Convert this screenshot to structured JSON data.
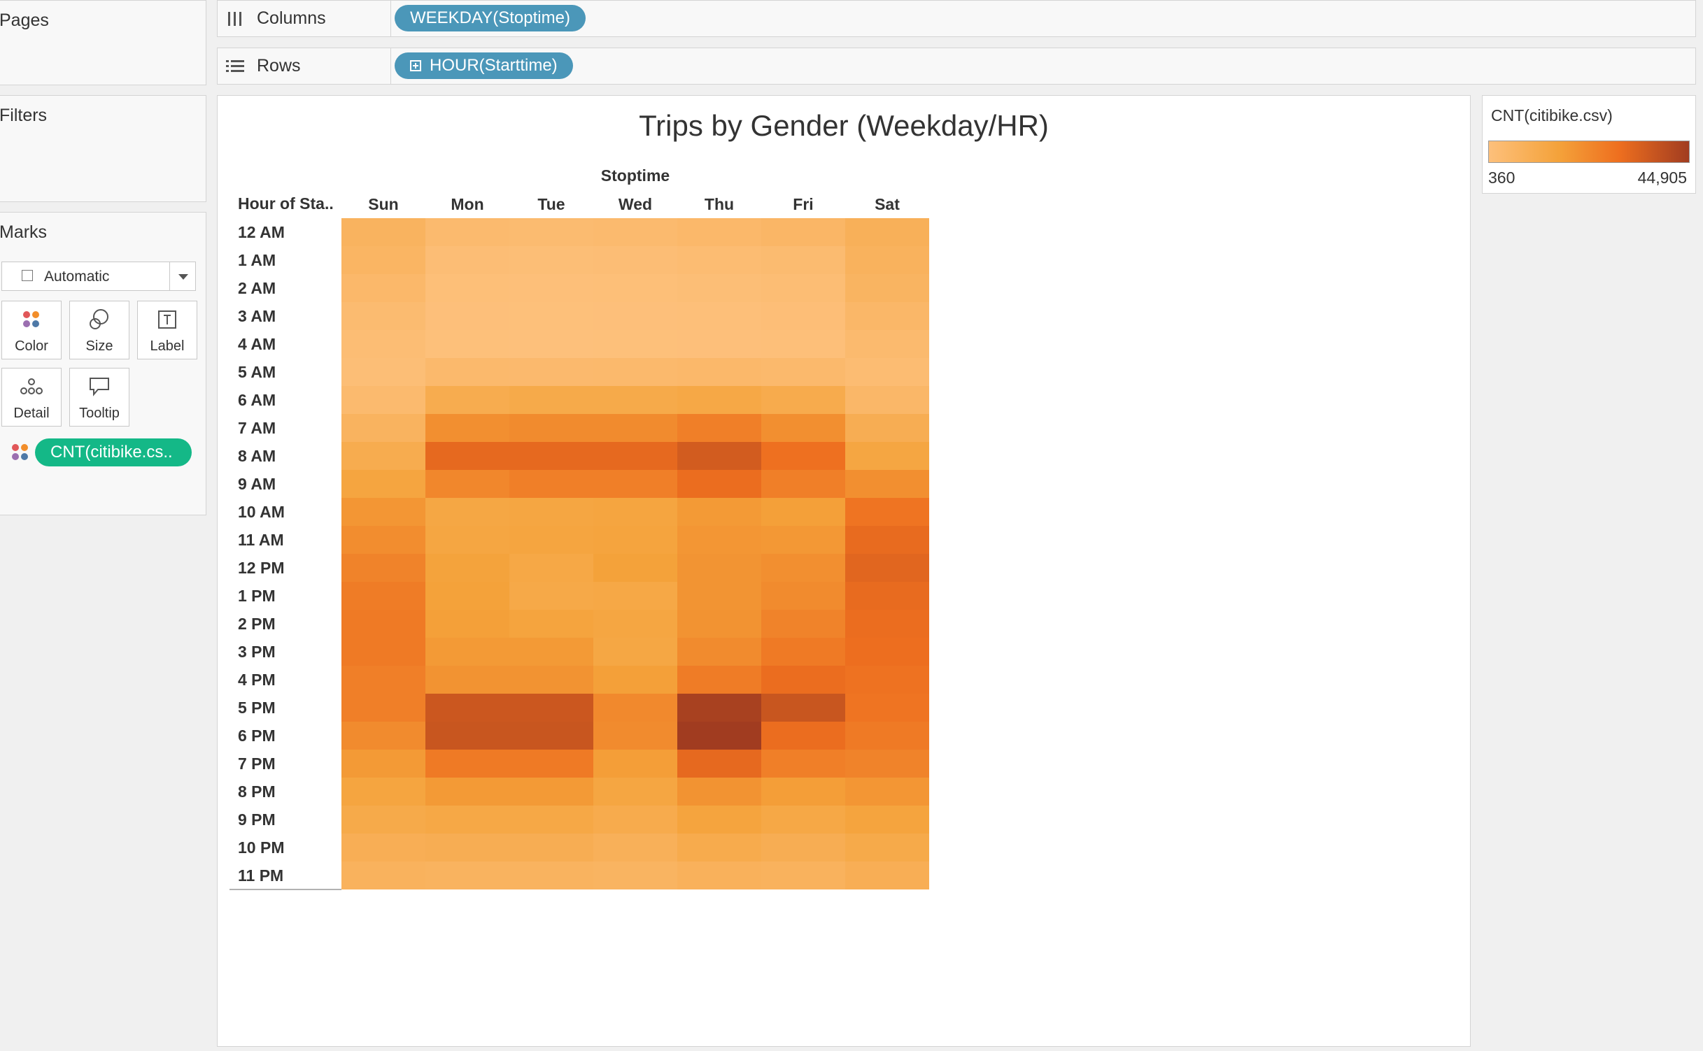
{
  "pages": {
    "title": "Pages"
  },
  "filters": {
    "title": "Filters"
  },
  "marks": {
    "title": "Marks",
    "type": "Automatic",
    "buttons": [
      {
        "label": "Color",
        "icon": "color-dots-icon"
      },
      {
        "label": "Size",
        "icon": "size-icon"
      },
      {
        "label": "Label",
        "icon": "label-icon"
      },
      {
        "label": "Detail",
        "icon": "detail-icon"
      },
      {
        "label": "Tooltip",
        "icon": "tooltip-icon"
      }
    ],
    "color_field": "CNT(citibike.cs.."
  },
  "shelves": {
    "columns": {
      "label": "Columns",
      "pill": "WEEKDAY(Stoptime)"
    },
    "rows": {
      "label": "Rows",
      "pill": "HOUR(Starttime)"
    }
  },
  "legend": {
    "title": "CNT(citibike.csv)",
    "min": "360",
    "max": "44,905",
    "color_low": "#fdc07b",
    "color_mid": "#ee6f1f",
    "color_high": "#a13c20"
  },
  "chart_data": {
    "type": "heatmap",
    "title": "Trips by Gender (Weekday/HR)",
    "column_header": "Stoptime",
    "row_header": "Hour of Sta..",
    "x": [
      "Sun",
      "Mon",
      "Tue",
      "Wed",
      "Thu",
      "Fri",
      "Sat"
    ],
    "y": [
      "12 AM",
      "1 AM",
      "2 AM",
      "3 AM",
      "4 AM",
      "5 AM",
      "6 AM",
      "7 AM",
      "8 AM",
      "9 AM",
      "10 AM",
      "11 AM",
      "12 PM",
      "1 PM",
      "2 PM",
      "3 PM",
      "4 PM",
      "5 PM",
      "6 PM",
      "7 PM",
      "8 PM",
      "9 PM",
      "10 PM",
      "11 PM"
    ],
    "values": [
      [
        7000,
        3500,
        3000,
        3500,
        4500,
        5500,
        8500
      ],
      [
        6000,
        1800,
        1500,
        1800,
        2500,
        3000,
        7500
      ],
      [
        4500,
        1000,
        900,
        1000,
        1500,
        2000,
        6500
      ],
      [
        3000,
        700,
        600,
        700,
        900,
        1200,
        5000
      ],
      [
        2000,
        500,
        400,
        500,
        700,
        900,
        3500
      ],
      [
        1500,
        4000,
        3800,
        4000,
        4500,
        4000,
        2500
      ],
      [
        3500,
        11000,
        12000,
        12000,
        13000,
        11500,
        5000
      ],
      [
        7000,
        21000,
        22000,
        22000,
        25000,
        21000,
        10000
      ],
      [
        11000,
        31000,
        31000,
        31000,
        35000,
        29000,
        14000
      ],
      [
        14500,
        23000,
        25000,
        25000,
        30000,
        25000,
        21000
      ],
      [
        19000,
        13500,
        14000,
        14500,
        18000,
        16500,
        28000
      ],
      [
        21500,
        14000,
        14500,
        15000,
        19000,
        18500,
        30500
      ],
      [
        24000,
        15500,
        13000,
        16000,
        19500,
        21000,
        32000
      ],
      [
        26000,
        16000,
        12500,
        13000,
        19500,
        22000,
        30500
      ],
      [
        26500,
        16500,
        15000,
        14000,
        20000,
        24000,
        30000
      ],
      [
        26500,
        18000,
        18000,
        13500,
        22000,
        26500,
        29500
      ],
      [
        25000,
        20000,
        20000,
        16500,
        26000,
        30000,
        28500
      ],
      [
        25000,
        36500,
        36500,
        22500,
        43500,
        37000,
        28000
      ],
      [
        22000,
        37000,
        37000,
        22000,
        44905,
        30000,
        26500
      ],
      [
        18000,
        26500,
        26500,
        17000,
        31000,
        25000,
        24000
      ],
      [
        14500,
        18000,
        18000,
        14000,
        20000,
        17000,
        19000
      ],
      [
        12000,
        13000,
        13000,
        11500,
        15000,
        13000,
        15000
      ],
      [
        9500,
        10000,
        10000,
        8500,
        11500,
        10000,
        12000
      ],
      [
        7500,
        7000,
        7000,
        6500,
        8000,
        7500,
        9500
      ]
    ],
    "scale": {
      "min": 360,
      "max": 44905
    }
  }
}
